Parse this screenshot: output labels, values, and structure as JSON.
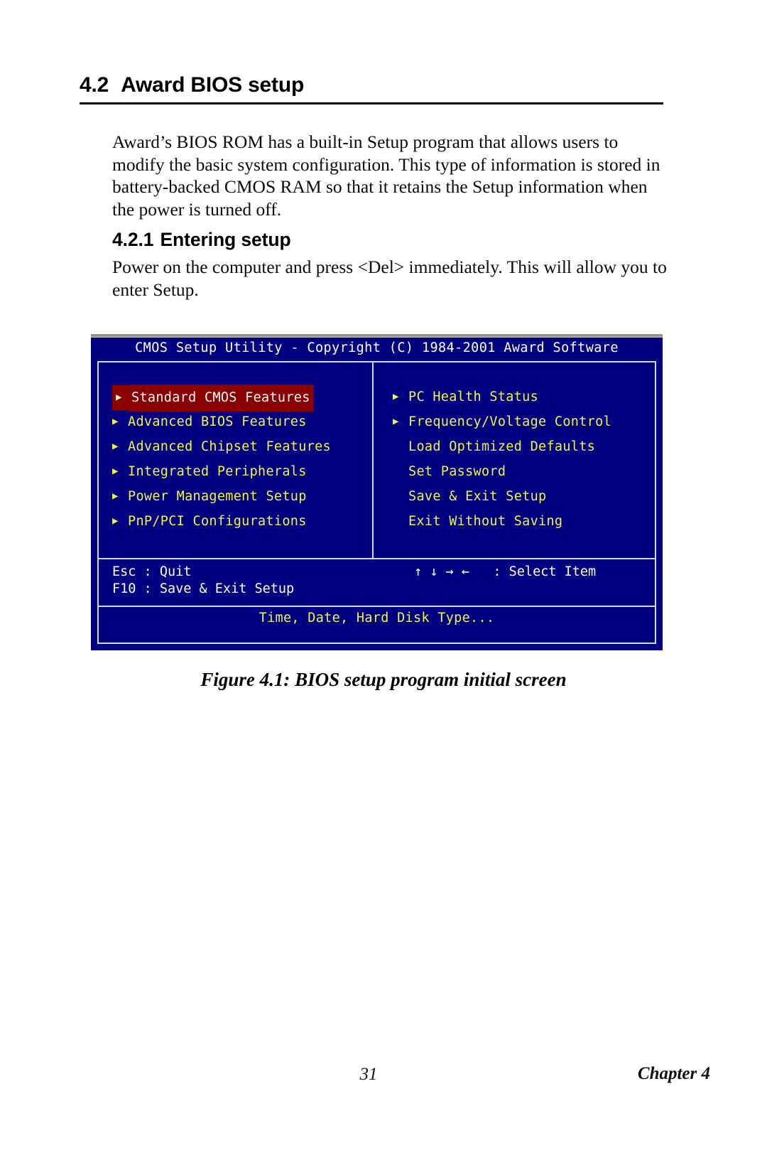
{
  "document": {
    "section": {
      "number": "4.2",
      "title": "Award BIOS setup"
    },
    "intro_paragraph": "Award’s BIOS ROM has a built-in Setup program that allows users to modify the basic system configuration. This type of information is stored in battery-backed CMOS RAM so that it retains the Setup information when the power is turned off.",
    "subsection": {
      "number": "4.2.1",
      "title": "Entering setup"
    },
    "subsection_paragraph": "Power on the computer and press <Del> immediately. This will allow you to enter Setup.",
    "figure_caption": "Figure 4.1: BIOS setup program initial screen",
    "footer": {
      "page_number": "31",
      "chapter": "Chapter 4"
    }
  },
  "bios": {
    "title_bar": "CMOS Setup Utility - Copyright (C) 1984-2001 Award Software",
    "bullet_glyph": "▶",
    "left_menu": [
      {
        "label": "Standard CMOS Features",
        "bullet": true,
        "selected": true
      },
      {
        "label": "Advanced BIOS Features",
        "bullet": true,
        "selected": false
      },
      {
        "label": "Advanced Chipset Features",
        "bullet": true,
        "selected": false
      },
      {
        "label": "Integrated Peripherals",
        "bullet": true,
        "selected": false
      },
      {
        "label": "Power Management Setup",
        "bullet": true,
        "selected": false
      },
      {
        "label": "PnP/PCI Configurations",
        "bullet": true,
        "selected": false
      }
    ],
    "right_menu": [
      {
        "label": "PC Health Status",
        "bullet": true,
        "selected": false
      },
      {
        "label": "Frequency/Voltage Control",
        "bullet": true,
        "selected": false
      },
      {
        "label": "Load Optimized Defaults",
        "bullet": false,
        "selected": false
      },
      {
        "label": "Set Password",
        "bullet": false,
        "selected": false
      },
      {
        "label": "Save & Exit Setup",
        "bullet": false,
        "selected": false
      },
      {
        "label": "Exit Without Saving",
        "bullet": false,
        "selected": false
      }
    ],
    "help_keys_left": "Esc : Quit\nF10 : Save & Exit Setup",
    "help_keys_right": "↑ ↓ → ←   : Select Item",
    "status_line": "Time, Date, Hard Disk Type...",
    "colors": {
      "background": "#000080",
      "text": "#f2f24a",
      "highlight_background": "#8b0000",
      "highlight_text": "#ffffff",
      "border": "#d8d8f0",
      "title_text": "#ffffff"
    }
  }
}
